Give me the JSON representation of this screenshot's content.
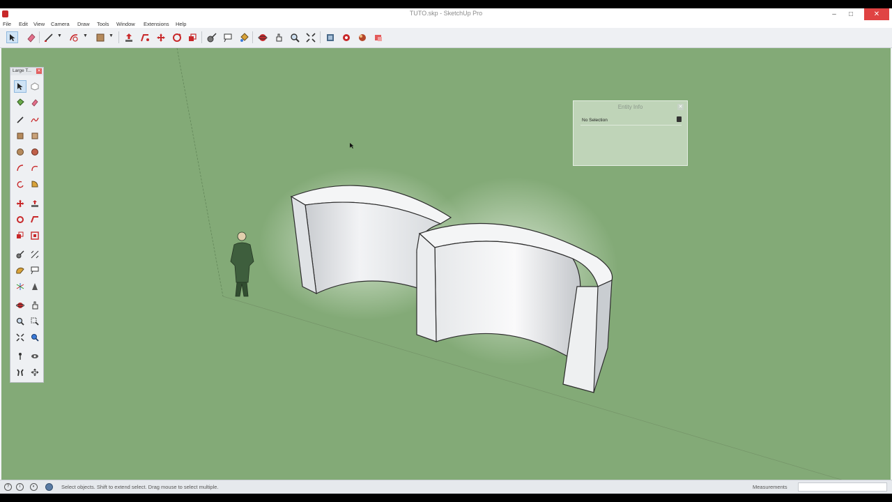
{
  "window": {
    "title": "TUTO.skp - SketchUp Pro",
    "controls": {
      "minimize": "–",
      "maximize": "□",
      "close": "✕"
    }
  },
  "menu": [
    "File",
    "Edit",
    "View",
    "Camera",
    "Draw",
    "Tools",
    "Window",
    "Extensions",
    "Help"
  ],
  "toolbar": {
    "icons": [
      "select-icon",
      "eraser-icon",
      "line-icon",
      "arc-icon",
      "rectangle-icon",
      "push-pull-icon",
      "follow-me-icon",
      "move-icon",
      "rotate-icon",
      "scale-icon",
      "tape-measure-icon",
      "text-icon",
      "paint-bucket-icon",
      "orbit-icon",
      "pan-icon",
      "zoom-icon",
      "zoom-extents-icon",
      "warehouse-icon",
      "extension-warehouse-icon",
      "layout-icon",
      "style-icon"
    ]
  },
  "large_tool_set": {
    "title": "Large T...",
    "close_label": "✕"
  },
  "entity_info": {
    "title": "Entity Info",
    "status": "No Selection",
    "close_label": "✕"
  },
  "statusbar": {
    "hint": "Select objects. Shift to extend select. Drag mouse to select multiple.",
    "measurements_label": "Measurements",
    "icons": [
      "geo-location-icon",
      "credits-icon",
      "info-icon",
      "instructor-icon"
    ]
  },
  "colors": {
    "viewport_bg": "#83aa77",
    "accent_red": "#c8282a",
    "accent_active": "#cfe3f5"
  }
}
